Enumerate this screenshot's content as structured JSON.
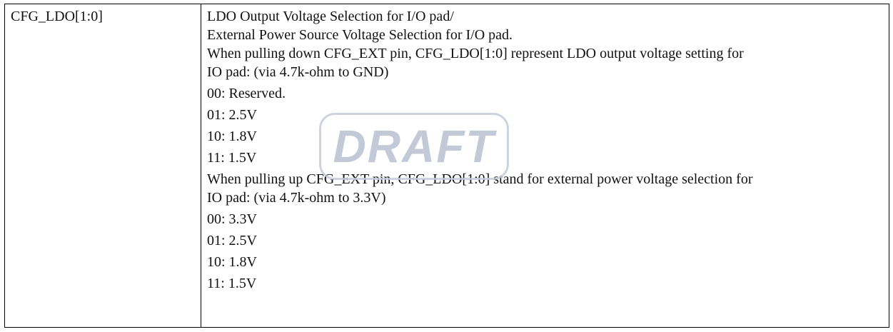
{
  "row": {
    "name": "CFG_LDO[1:0]",
    "description": {
      "heading_1": "LDO Output Voltage Selection for I/O pad/",
      "heading_2": "External Power Source Voltage Selection for I/O pad.",
      "pull_down_1": "When pulling down CFG_EXT pin, CFG_LDO[1:0] represent LDO output voltage setting for",
      "pull_down_2": "IO pad: (via 4.7k-ohm to GND)",
      "pull_down_options": [
        "00: Reserved.",
        "01: 2.5V",
        "10: 1.8V",
        "11: 1.5V"
      ],
      "pull_up_1": "When pulling up CFG_EXT pin, CFG_LDO[1:0] stand for external power voltage selection for",
      "pull_up_2": "IO pad: (via 4.7k-ohm to 3.3V)",
      "pull_up_options": [
        "00: 3.3V",
        "01: 2.5V",
        "10: 1.8V",
        "11: 1.5V"
      ]
    }
  },
  "watermark": {
    "text": "DRAFT",
    "color": "#b9c0cf"
  }
}
